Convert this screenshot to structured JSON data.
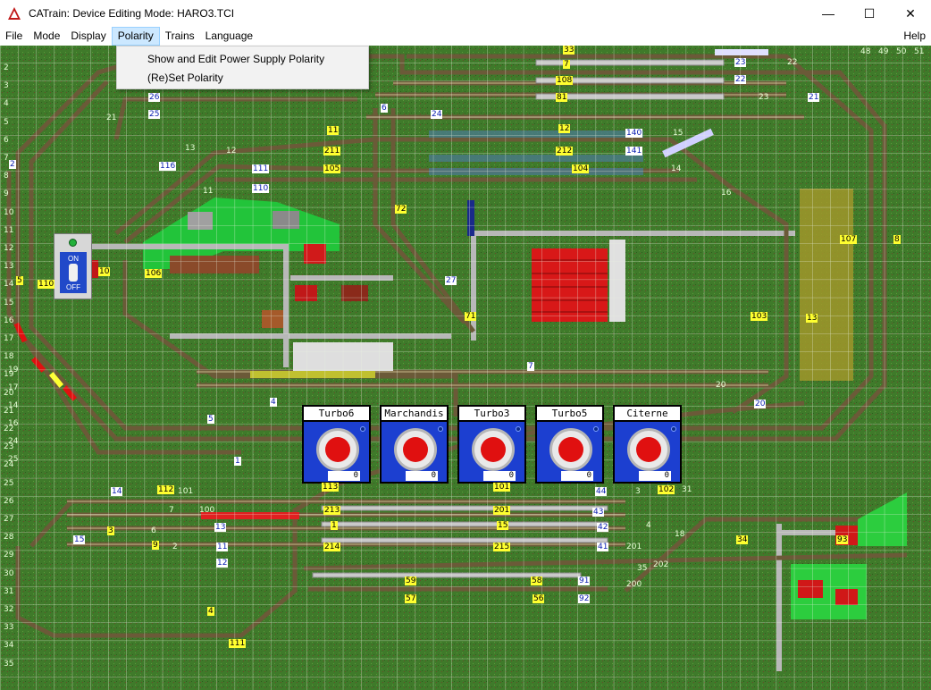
{
  "window": {
    "title": "CATrain: Device Editing Mode: HARO3.TCI",
    "minimize": "—",
    "maximize": "☐",
    "close": "✕"
  },
  "menu": {
    "file": "File",
    "mode": "Mode",
    "display": "Display",
    "polarity": "Polarity",
    "trains": "Trains",
    "language": "Language",
    "help": "Help"
  },
  "polarity_menu": {
    "items": [
      "Show and Edit Power Supply Polarity",
      "(Re)Set Polarity"
    ]
  },
  "onoff": {
    "on": "ON",
    "off": "OFF"
  },
  "controllers": [
    {
      "name": "Turbo6",
      "speed": "0"
    },
    {
      "name": "Marchandis",
      "speed": "0"
    },
    {
      "name": "Turbo3",
      "speed": "0"
    },
    {
      "name": "Turbo5",
      "speed": "0"
    },
    {
      "name": "Citerne",
      "speed": "0"
    }
  ],
  "grid": {
    "col_labels": [
      "48",
      "49",
      "50",
      "51"
    ],
    "row_labels": [
      "2",
      "3",
      "4",
      "5",
      "6",
      "7",
      "8",
      "9",
      "10",
      "11",
      "12",
      "13",
      "14",
      "15",
      "16",
      "17",
      "18",
      "19",
      "20",
      "21",
      "22",
      "23",
      "24",
      "25",
      "26",
      "27",
      "28",
      "29",
      "30",
      "31",
      "32",
      "33",
      "34",
      "35"
    ]
  },
  "labels": {
    "yellow": [
      "33",
      "7",
      "108",
      "81",
      "11",
      "211",
      "105",
      "12",
      "212",
      "104",
      "72",
      "107",
      "8",
      "110",
      "106",
      "10",
      "5",
      "71",
      "103",
      "13",
      "112",
      "213",
      "201",
      "102",
      "1",
      "15",
      "214",
      "215",
      "59",
      "58",
      "57",
      "56",
      "34",
      "93",
      "4",
      "111",
      "113",
      "101",
      "9",
      "3"
    ],
    "blue": [
      "23",
      "22",
      "21",
      "26",
      "25",
      "6",
      "24",
      "140",
      "141",
      "116",
      "111",
      "110",
      "2",
      "27",
      "7",
      "4",
      "5",
      "20",
      "1",
      "14",
      "44",
      "43",
      "42",
      "41",
      "13",
      "11",
      "12",
      "15",
      "91",
      "92"
    ],
    "green": [
      "22",
      "23",
      "21",
      "15",
      "14",
      "13",
      "12",
      "11",
      "16",
      "20",
      "101",
      "7",
      "100",
      "6",
      "2",
      "3",
      "31",
      "4",
      "201",
      "202",
      "200",
      "35",
      "18",
      "19",
      "17",
      "14",
      "16",
      "24",
      "25"
    ]
  },
  "colors": {
    "grass": "#3f7a2a",
    "grid": "#e8f0e0",
    "track": "#6b5a38",
    "road": "#b0b0b0",
    "building": "#d01a1a",
    "controller": "#1c3fd0",
    "label_yellow": "#ffff30"
  }
}
